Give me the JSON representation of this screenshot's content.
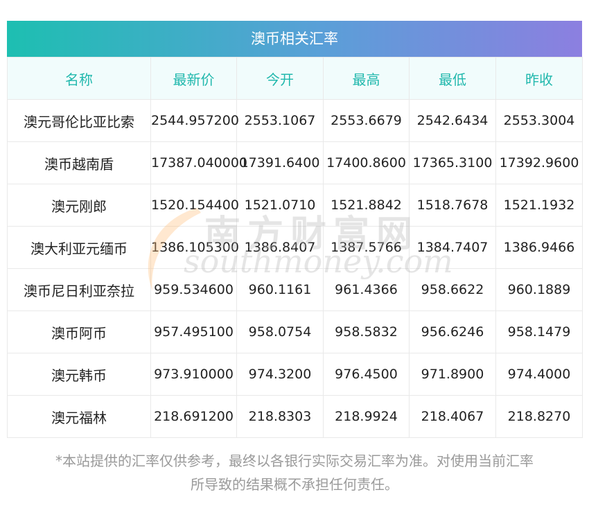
{
  "table": {
    "title": "澳币相关汇率",
    "headers": [
      "名称",
      "最新价",
      "今开",
      "最高",
      "最低",
      "昨收"
    ],
    "rows": [
      [
        "澳元哥伦比亚比索",
        "2544.957200",
        "2553.1067",
        "2553.6679",
        "2542.6434",
        "2553.3004"
      ],
      [
        "澳币越南盾",
        "17387.040000",
        "17391.6400",
        "17400.8600",
        "17365.3100",
        "17392.9600"
      ],
      [
        "澳元刚郎",
        "1520.154400",
        "1521.0710",
        "1521.8842",
        "1518.7678",
        "1521.1932"
      ],
      [
        "澳大利亚元缅币",
        "1386.105300",
        "1386.8407",
        "1387.5766",
        "1384.7407",
        "1386.9466"
      ],
      [
        "澳币尼日利亚奈拉",
        "959.534600",
        "960.1161",
        "961.4366",
        "958.6622",
        "960.1889"
      ],
      [
        "澳币阿币",
        "957.495100",
        "958.0754",
        "958.5832",
        "956.6246",
        "958.1479"
      ],
      [
        "澳元韩币",
        "973.910000",
        "974.3200",
        "976.4500",
        "971.8900",
        "974.4000"
      ],
      [
        "澳元福林",
        "218.691200",
        "218.8303",
        "218.9924",
        "218.4067",
        "218.8270"
      ]
    ]
  },
  "watermark": {
    "cn": "南方财富网",
    "en": "southmoney.com"
  },
  "note": {
    "line1": "*本站提供的汇率仅供参考，最终以各银行实际交易汇率为准。对使用当前汇率",
    "line2": "所导致的结果概不承担任何责任。"
  },
  "colors": {
    "header_gradient_start": "#1dbfb1",
    "header_gradient_end": "#8c7fe0",
    "header_text": "#21b8ad",
    "header_bg": "#f1fcfc"
  }
}
